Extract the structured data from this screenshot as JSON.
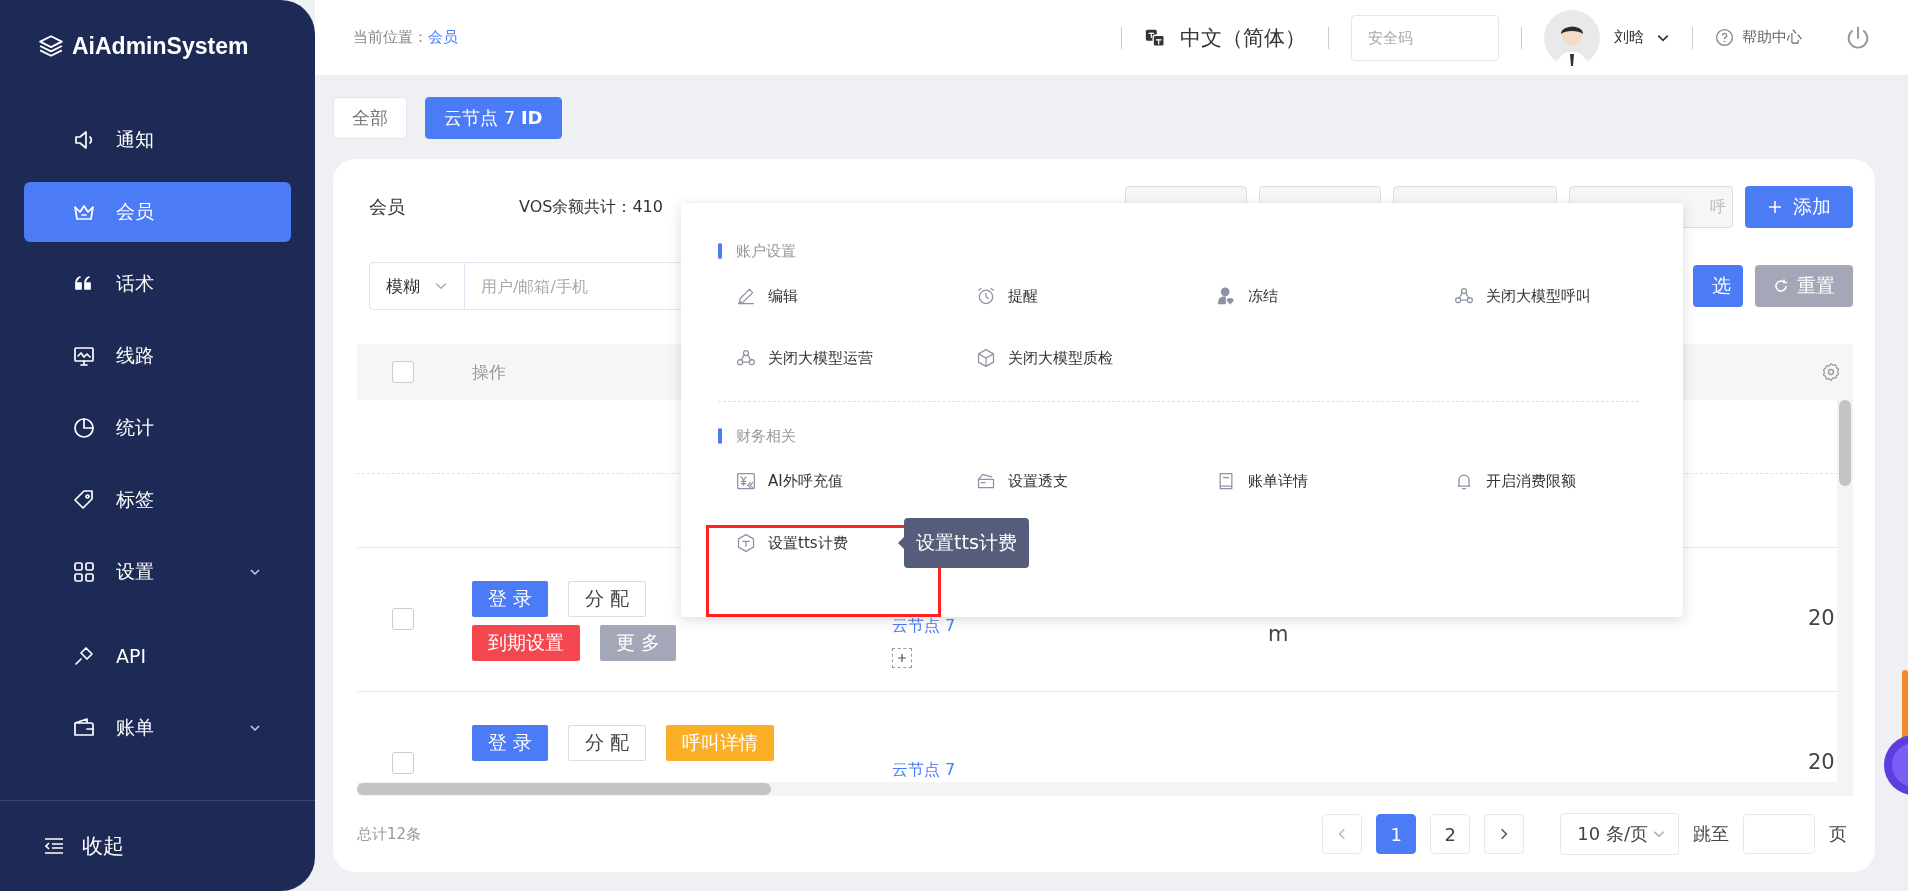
{
  "sidebar": {
    "logo": "AiAdminSystem",
    "items": [
      {
        "label": "通知",
        "selected": false,
        "expandable": false
      },
      {
        "label": "会员",
        "selected": true,
        "expandable": false
      },
      {
        "label": "话术",
        "selected": false,
        "expandable": false
      },
      {
        "label": "线路",
        "selected": false,
        "expandable": false
      },
      {
        "label": "统计",
        "selected": false,
        "expandable": false
      },
      {
        "label": "标签",
        "selected": false,
        "expandable": false
      },
      {
        "label": "设置",
        "selected": false,
        "expandable": true
      },
      {
        "label": "API",
        "selected": false,
        "expandable": false
      },
      {
        "label": "账单",
        "selected": false,
        "expandable": true
      }
    ],
    "collapse": "收起"
  },
  "header": {
    "breadcrumb_label": "当前位置：",
    "breadcrumb_current": "会员",
    "language": "中文（简体）",
    "security_code": {
      "placeholder": "安全码"
    },
    "user": "刘晗",
    "help": "帮助中心"
  },
  "tabs": [
    {
      "label": "全部",
      "selected": false
    },
    {
      "label": "云节点 7  **ID**",
      "selected": true
    }
  ],
  "panel": {
    "title": "会员",
    "balance": "VOS余额共计：410",
    "covered_button_text": "呼",
    "add_button": "添加"
  },
  "filter": {
    "mode": "模糊",
    "search": {
      "placeholder": "用户/邮箱/手机"
    },
    "search_button": "选",
    "reset_button": "重置"
  },
  "table": {
    "select_all": {
      "checked": false
    },
    "operation_header": "操作",
    "rows": [
      {
        "checked": false,
        "actions": [
          [
            {
              "label": "登 录",
              "kind": "primary"
            },
            {
              "label": "分 配",
              "kind": "plain"
            }
          ],
          [
            {
              "label": "到期设置",
              "kind": "danger"
            },
            {
              "label": "更 多",
              "kind": "muted"
            }
          ]
        ],
        "node": "云节点 7",
        "add_tag": true,
        "column_4": "m",
        "column_6": "20"
      },
      {
        "checked": false,
        "actions": [
          [
            {
              "label": "登 录",
              "kind": "primary"
            },
            {
              "label": "分 配",
              "kind": "plain"
            },
            {
              "label": "呼叫详情",
              "kind": "warning"
            }
          ]
        ],
        "node": "云节点 7",
        "add_tag": false,
        "column_6": "20"
      }
    ]
  },
  "menu": {
    "sections": [
      {
        "title": "账户设置",
        "items": [
          {
            "label": "编辑"
          },
          {
            "label": "提醒"
          },
          {
            "label": "冻结"
          },
          {
            "label": "关闭大模型呼叫"
          },
          {
            "label": "关闭大模型运营"
          },
          {
            "label": "关闭大模型质检"
          }
        ]
      },
      {
        "title": "财务相关",
        "items": [
          {
            "label": "AI外呼充值"
          },
          {
            "label": "设置透支"
          },
          {
            "label": "账单详情"
          },
          {
            "label": "开启消费限额"
          },
          {
            "label": "设置tts计费",
            "tooltip": "设置tts计费"
          }
        ]
      }
    ]
  },
  "pagination": {
    "total": "总计12条",
    "pages": [
      {
        "label": "1",
        "selected": true
      },
      {
        "label": "2",
        "selected": false
      }
    ],
    "page_size": "10 条/页",
    "jump_label": "跳至",
    "page_suffix": "页"
  }
}
